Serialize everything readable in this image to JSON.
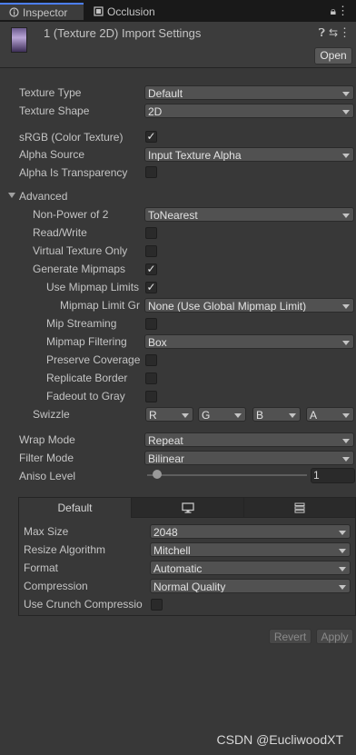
{
  "tabs": [
    {
      "label": "Inspector",
      "icon": "info-icon"
    },
    {
      "label": "Occlusion",
      "icon": "occlusion-icon"
    }
  ],
  "header": {
    "title": "1 (Texture 2D) Import Settings",
    "open_label": "Open"
  },
  "rows": {
    "texture_type": {
      "label": "Texture Type",
      "value": "Default"
    },
    "texture_shape": {
      "label": "Texture Shape",
      "value": "2D"
    },
    "srgb": {
      "label": "sRGB (Color Texture)",
      "checked": true
    },
    "alpha_source": {
      "label": "Alpha Source",
      "value": "Input Texture Alpha"
    },
    "alpha_transparency": {
      "label": "Alpha Is Transparency",
      "checked": false
    },
    "advanced": {
      "label": "Advanced"
    },
    "npot": {
      "label": "Non-Power of 2",
      "value": "ToNearest"
    },
    "read_write": {
      "label": "Read/Write",
      "checked": false
    },
    "virtual_texture": {
      "label": "Virtual Texture Only",
      "checked": false
    },
    "generate_mipmaps": {
      "label": "Generate Mipmaps",
      "checked": true
    },
    "use_mipmap_limits": {
      "label": "Use Mipmap Limits",
      "checked": true
    },
    "mipmap_limit_group": {
      "label": "Mipmap Limit Gr",
      "value": "None (Use Global Mipmap Limit)"
    },
    "mip_streaming": {
      "label": "Mip Streaming",
      "checked": false
    },
    "mipmap_filtering": {
      "label": "Mipmap Filtering",
      "value": "Box"
    },
    "preserve_coverage": {
      "label": "Preserve Coverage",
      "checked": false
    },
    "replicate_border": {
      "label": "Replicate Border",
      "checked": false
    },
    "fadeout_gray": {
      "label": "Fadeout to Gray",
      "checked": false
    },
    "swizzle": {
      "label": "Swizzle",
      "values": [
        "R",
        "G",
        "B",
        "A"
      ]
    },
    "wrap_mode": {
      "label": "Wrap Mode",
      "value": "Repeat"
    },
    "filter_mode": {
      "label": "Filter Mode",
      "value": "Bilinear"
    },
    "aniso_level": {
      "label": "Aniso Level",
      "value": "1",
      "level_fraction": 0.0625
    }
  },
  "platform": {
    "tabs": [
      {
        "label": "Default"
      },
      {
        "icon": "monitor-icon"
      },
      {
        "icon": "server-icon"
      }
    ],
    "max_size": {
      "label": "Max Size",
      "value": "2048"
    },
    "resize_algorithm": {
      "label": "Resize Algorithm",
      "value": "Mitchell"
    },
    "format": {
      "label": "Format",
      "value": "Automatic"
    },
    "compression": {
      "label": "Compression",
      "value": "Normal Quality"
    },
    "crunch": {
      "label": "Use Crunch Compressio",
      "checked": false
    }
  },
  "actions": {
    "revert": "Revert",
    "apply": "Apply"
  },
  "watermark": "CSDN @EucliwoodXT",
  "colors": {
    "accent": "#4c7fff",
    "background": "#383838",
    "check": "#e6e6e6"
  }
}
